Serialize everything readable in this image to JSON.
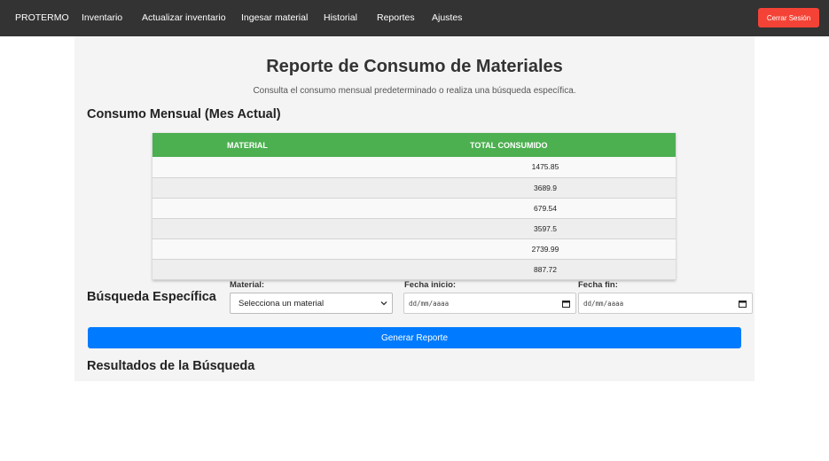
{
  "nav": {
    "brand": "PROTERMO",
    "items": [
      {
        "label": "Inventario"
      },
      {
        "label": "Actualizar inventario"
      },
      {
        "label": "Ingesar material"
      },
      {
        "label": "Historial"
      },
      {
        "label": "Reportes"
      },
      {
        "label": "Ajustes"
      }
    ],
    "logout_label": "Cerrar Sesión"
  },
  "page": {
    "title": "Reporte de Consumo de Materiales",
    "subtitle": "Consulta el consumo mensual predeterminado o realiza una búsqueda específica."
  },
  "monthly": {
    "heading": "Consumo Mensual (Mes Actual)",
    "columns": [
      "MATERIAL",
      "TOTAL CONSUMIDO"
    ],
    "rows": [
      {
        "material": "",
        "total": "1475.85"
      },
      {
        "material": "",
        "total": "3689.9"
      },
      {
        "material": "",
        "total": "679.54"
      },
      {
        "material": "",
        "total": "3597.5"
      },
      {
        "material": "",
        "total": "2739.99"
      },
      {
        "material": "",
        "total": "887.72"
      }
    ]
  },
  "search": {
    "heading": "Búsqueda Específica",
    "material_label": "Material:",
    "material_value": "Selecciona un material",
    "start_label": "Fecha inicio:",
    "start_placeholder": "dd/mm/aaaa",
    "end_label": "Fecha fin:",
    "end_placeholder": "dd/mm/aaaa",
    "button_label": "Generar Reporte"
  },
  "results": {
    "heading": "Resultados de la Búsqueda"
  },
  "colors": {
    "navbar": "#333333",
    "logout": "#f44336",
    "table_header": "#4caf50",
    "primary_button": "#007bff"
  }
}
